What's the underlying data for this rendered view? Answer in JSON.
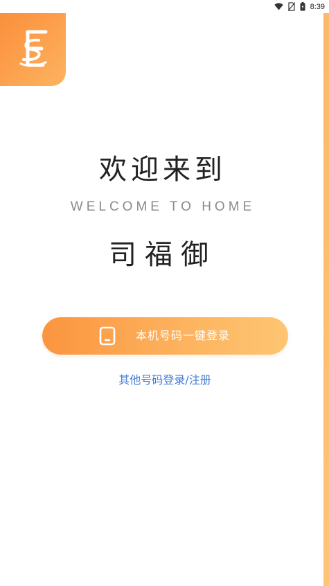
{
  "status_bar": {
    "time": "8:39",
    "icons": [
      "wifi-icon",
      "no-sim-icon",
      "battery-icon"
    ]
  },
  "logo": {
    "icon": "brand-logo-icon",
    "accent_start": "#fb8f3c",
    "accent_end": "#fdb35f"
  },
  "welcome": {
    "title": "欢迎来到",
    "subtitle": "WELCOME TO HOME",
    "brand": "司福御"
  },
  "login": {
    "one_click_label": "本机号码一键登录",
    "one_click_icon": "phone-icon",
    "other_label": "其他号码登录/注册",
    "link_color": "#3f7ad6"
  }
}
